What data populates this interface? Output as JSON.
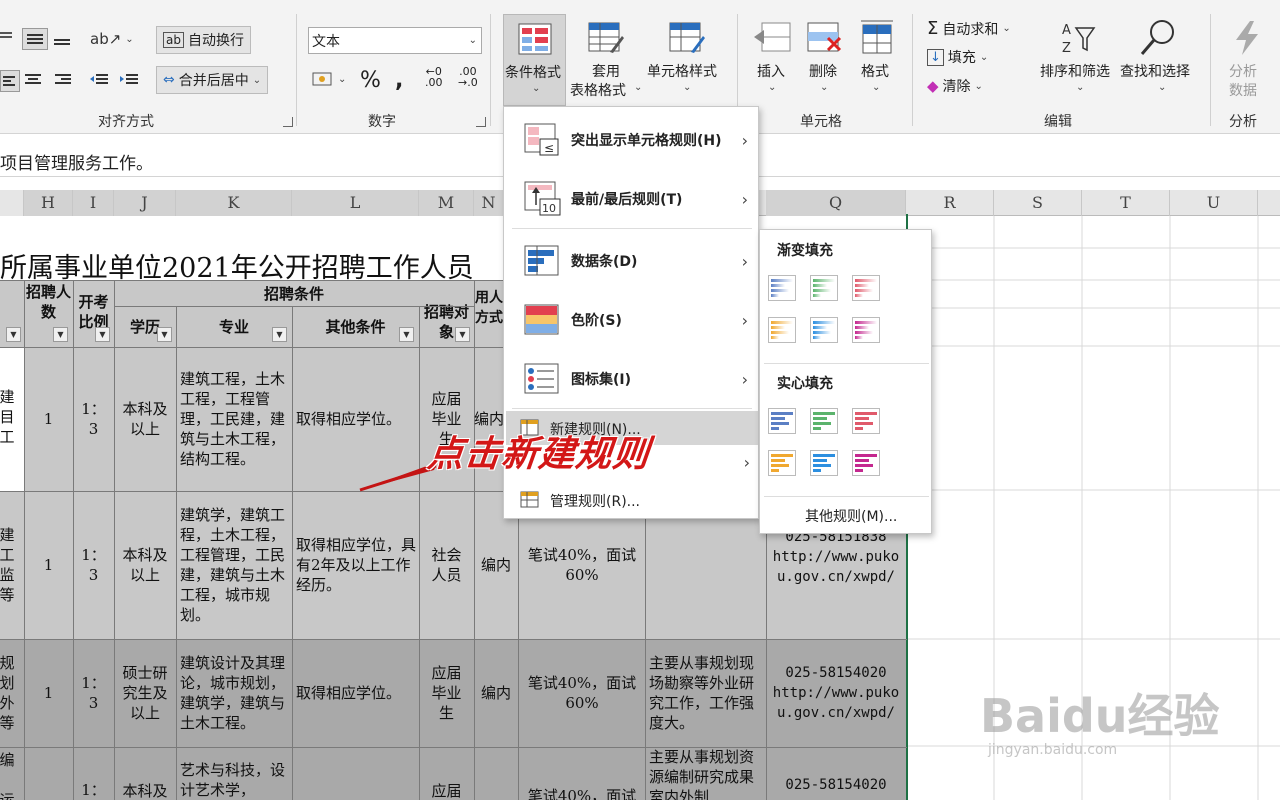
{
  "ribbon": {
    "wrap_text": "自动换行",
    "merge_center": "合并后居中",
    "align_group": "对齐方式",
    "number_format": "文本",
    "number_group": "数字",
    "conditional_format": "条件格式",
    "table_format_line1": "套用",
    "table_format_line2": "表格格式",
    "cell_style": "单元格样式",
    "insert": "插入",
    "delete": "删除",
    "format": "格式",
    "cells_group": "单元格",
    "autosum": "自动求和",
    "fill": "填充",
    "clear": "清除",
    "sort_filter": "排序和筛选",
    "find_select": "查找和选择",
    "edit_group": "编辑",
    "analyze_line1": "分析",
    "analyze_line2": "数据",
    "analyze_group": "分析"
  },
  "formula_bar": {
    "value": "项目管理服务工作。"
  },
  "columns": [
    "H",
    "I",
    "J",
    "K",
    "L",
    "M",
    "N",
    "Q",
    "R",
    "S",
    "T",
    "U"
  ],
  "sheet": {
    "title": "所属事业单位2021年公开招聘工作人员",
    "hdr_count": "招聘人数",
    "hdr_ratio": "开考比例",
    "hdr_conditions": "招聘条件",
    "hdr_edu": "学历",
    "hdr_major": "专业",
    "hdr_other": "其他条件",
    "hdr_target": "招聘对象",
    "hdr_method": "用人方式",
    "rows": [
      {
        "left": "建\n目\n工",
        "count": "1",
        "ratio": "1：\n3",
        "edu": "本科及\n以上",
        "major": "建筑工程，土木工程，工程管理，工民建，建筑与土木工程，结构工程。",
        "other": "取得相应学位。",
        "target": "应届\n毕业\n生",
        "method": "编内",
        "exam": "",
        "duty": "",
        "contact": ""
      },
      {
        "left": "建\n工\n监\n等",
        "count": "1",
        "ratio": "1：\n3",
        "edu": "本科及\n以上",
        "major": "建筑学，建筑工程，土木工程，工程管理，工民建，建筑与土木工程，城市规划。",
        "other": "取得相应学位，具有2年及以上工作经历。",
        "target": "社会\n人员",
        "method": "编内",
        "exam": "笔试40%，面试60%",
        "duty": "",
        "contact": "025-58151838\nhttp://www.pukou.gov.cn/xwpd/"
      },
      {
        "left": "规\n划\n外\n等",
        "count": "1",
        "ratio": "1：\n3",
        "edu": "硕士研\n究生及\n以上",
        "major": "建筑设计及其理论，城市规划，建筑学，建筑与土木工程。",
        "other": "取得相应学位。",
        "target": "应届\n毕业\n生",
        "method": "编内",
        "exam": "笔试40%，面试60%",
        "duty": "主要从事规划现场勘察等外业研究工作，工作强度大。",
        "contact": "025-58154020\nhttp://www.pukou.gov.cn/xwpd/"
      },
      {
        "left": "编\n\n运",
        "count": "1",
        "ratio": "1：",
        "edu": "本科及",
        "major": "艺术与科技，设计艺术学，",
        "other": "",
        "target": "应届",
        "method": "",
        "exam": "笔试40%，面试",
        "duty": "主要从事规划资源编制研究成果室内外制",
        "contact": "025-58154020"
      }
    ]
  },
  "cf_menu": {
    "highlight_rules": "突出显示单元格规则(H)",
    "top_bottom": "最前/最后规则(T)",
    "data_bars": "数据条(D)",
    "color_scales": "色阶(S)",
    "icon_sets": "图标集(I)",
    "new_rule": "新建规则(N)...",
    "manage_rules": "管理规则(R)..."
  },
  "submenu": {
    "gradient_title": "渐变填充",
    "solid_title": "实心填充",
    "more_rules": "其他规则(M)...",
    "colors": [
      "#5b7fc4",
      "#5bb36c",
      "#e05a6b",
      "#f0a830",
      "#2d8fe0",
      "#c4288f"
    ]
  },
  "annotation": "点击新建规则",
  "watermark": {
    "brand": "Baidu经验",
    "url": "jingyan.baidu.com"
  }
}
